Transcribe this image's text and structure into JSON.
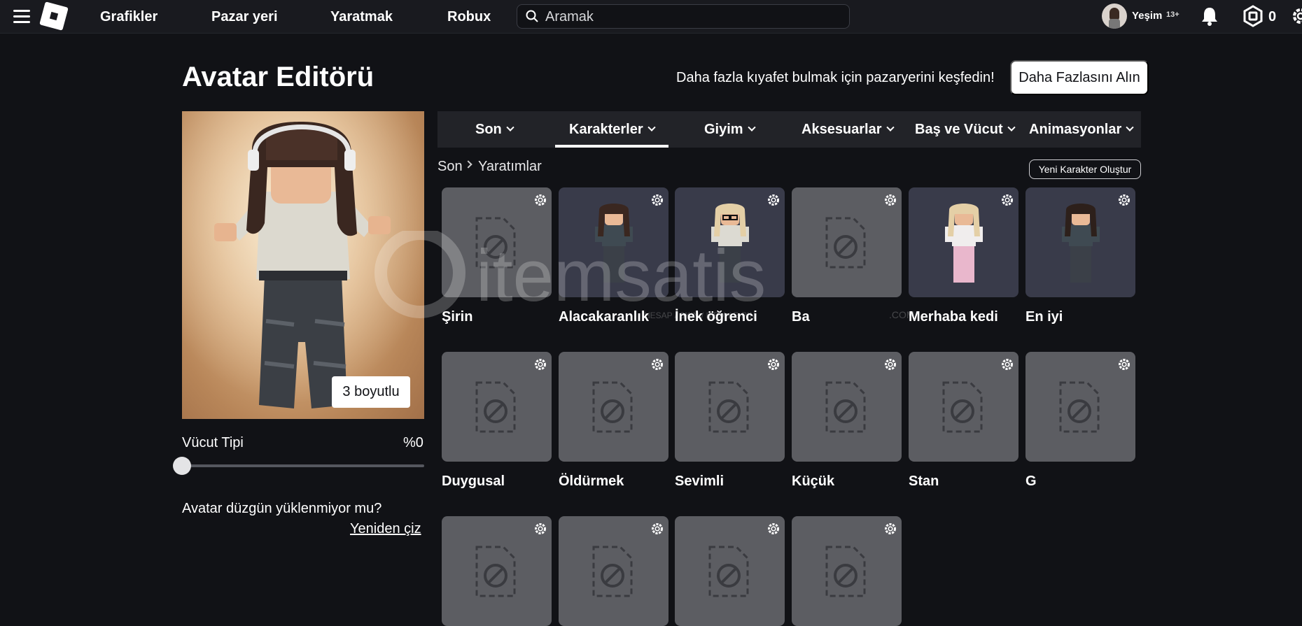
{
  "topbar": {
    "nav": [
      "Grafikler",
      "Pazar yeri",
      "Yaratmak",
      "Robux"
    ],
    "search_placeholder": "Aramak",
    "username": "Yeşim",
    "age_badge": "13+",
    "robux_balance": "0"
  },
  "header": {
    "title": "Avatar Editörü",
    "promo": "Daha fazla kıyafet bulmak için pazaryerini keşfedin!",
    "get_more": "Daha Fazlasını Alın"
  },
  "preview": {
    "btn_3d": "3 boyutlu",
    "body_type_label": "Vücut Tipi",
    "body_type_value": "%0",
    "body_type_level": 0,
    "reload_question": "Avatar düzgün yüklenmiyor mu?",
    "reload_link": "Yeniden çiz"
  },
  "tabs": [
    {
      "label": "Son",
      "active": false
    },
    {
      "label": "Karakterler",
      "active": true
    },
    {
      "label": "Giyim",
      "active": false
    },
    {
      "label": "Aksesuarlar",
      "active": false
    },
    {
      "label": "Baş ve Vücut",
      "active": false
    },
    {
      "label": "Animasyonlar",
      "active": false
    }
  ],
  "breadcrumb": {
    "root": "Son",
    "current": "Yaratımlar"
  },
  "new_character": "Yeni Karakter Oluştur",
  "characters": [
    {
      "name": "Şirin",
      "thumb": "placeholder"
    },
    {
      "name": "Alacakaranlık",
      "thumb": "avatar-brunette"
    },
    {
      "name": "İnek öğrenci",
      "thumb": "avatar-blonde-glasses"
    },
    {
      "name": "Ba",
      "thumb": "placeholder"
    },
    {
      "name": "Merhaba kedi",
      "thumb": "avatar-blonde-pink"
    },
    {
      "name": "En iyi",
      "thumb": "avatar-brunette-dark"
    },
    {
      "name": "Duygusal",
      "thumb": "placeholder"
    },
    {
      "name": "Öldürmek",
      "thumb": "placeholder"
    },
    {
      "name": "Sevimli",
      "thumb": "placeholder"
    },
    {
      "name": "Küçük",
      "thumb": "placeholder"
    },
    {
      "name": "Stan",
      "thumb": "placeholder"
    },
    {
      "name": "G",
      "thumb": "placeholder"
    },
    {
      "name": "",
      "thumb": "placeholder"
    },
    {
      "name": "",
      "thumb": "placeholder"
    },
    {
      "name": "",
      "thumb": "placeholder"
    },
    {
      "name": "",
      "thumb": "placeholder"
    }
  ],
  "colors": {
    "background": "#111216",
    "topbar": "#191a1f",
    "tab_bar": "#222328",
    "placeholder_tile": "#5c5d62",
    "avatar_tile": "#393b4a"
  },
  "watermark": {
    "brand": "itemsatis",
    "tagline": "HESAP / SKIN / ITEM / E-PIN",
    "suffix": ".COM"
  }
}
